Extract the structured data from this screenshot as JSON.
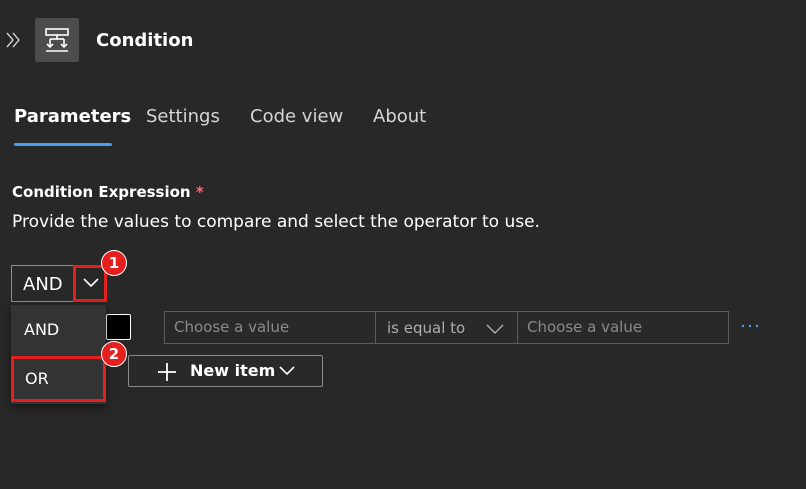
{
  "header": {
    "expand_icon": "double-chevron-right-icon",
    "node_icon": "condition-icon",
    "title": "Condition"
  },
  "tabs": [
    {
      "label": "Parameters",
      "active": true
    },
    {
      "label": "Settings",
      "active": false
    },
    {
      "label": "Code view",
      "active": false
    },
    {
      "label": "About",
      "active": false
    }
  ],
  "condition": {
    "label": "Condition Expression",
    "required_mark": "*",
    "description": "Provide the values to compare and select the operator to use.",
    "group_operator": "AND",
    "group_options": [
      "AND",
      "OR"
    ],
    "row": {
      "left_placeholder": "Choose a value",
      "operator": "is equal to",
      "right_placeholder": "Choose a value",
      "more_icon": "ellipsis-icon"
    },
    "new_item_label": "New item"
  },
  "annotations": [
    "1",
    "2"
  ],
  "colors": {
    "background": "#282828",
    "accent": "#479ef5",
    "highlight": "#e51e1e",
    "required": "#f1707b"
  }
}
